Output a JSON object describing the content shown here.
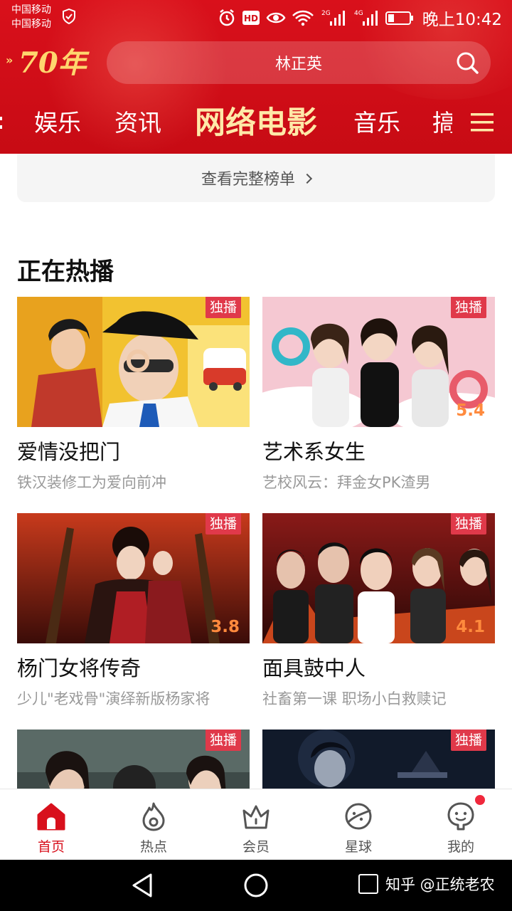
{
  "status_bar": {
    "carrier_line1": "中国移动",
    "carrier_line2": "中国移动",
    "network_1": "2G",
    "network_2": "4G",
    "time": "晚上10:42",
    "icons": [
      "shield-icon",
      "alarm-icon",
      "hd-icon",
      "eye-icon",
      "wifi-icon",
      "signal-icon",
      "battery-icon"
    ]
  },
  "header": {
    "logo_text": "70年",
    "search_text": "林正英",
    "tabs": [
      {
        "label": "娱乐",
        "active": false
      },
      {
        "label": "资讯",
        "active": false
      },
      {
        "label": "网络电影",
        "active": true
      },
      {
        "label": "音乐",
        "active": false
      },
      {
        "label": "搞",
        "active": false
      }
    ],
    "colors": {
      "bar": "#d4101a",
      "active_tab": "#ffe9a8"
    }
  },
  "content": {
    "full_list_label": "查看完整榜单",
    "section_title": "正在热播",
    "cards": [
      {
        "title": "爱情没把门",
        "subtitle": "铁汉装修工为爱向前冲",
        "badge": "独播",
        "score": ""
      },
      {
        "title": "艺术系女生",
        "subtitle": "艺校风云：拜金女PK渣男",
        "badge": "独播",
        "score": "5.4"
      },
      {
        "title": "杨门女将传奇",
        "subtitle": "少儿\"老戏骨\"演绎新版杨家将",
        "badge": "独播",
        "score": "3.8"
      },
      {
        "title": "面具鼓中人",
        "subtitle": "社畜第一课 职场小白救赎记",
        "badge": "独播",
        "score": "4.1"
      },
      {
        "title": "",
        "subtitle": "",
        "badge": "独播",
        "score": ""
      },
      {
        "title": "",
        "subtitle": "",
        "badge": "独播",
        "score": ""
      }
    ]
  },
  "bottom_nav": {
    "items": [
      {
        "label": "首页",
        "icon": "home-icon",
        "active": true
      },
      {
        "label": "热点",
        "icon": "flame-icon",
        "active": false
      },
      {
        "label": "会员",
        "icon": "crown-icon",
        "active": false
      },
      {
        "label": "星球",
        "icon": "planet-icon",
        "active": false
      },
      {
        "label": "我的",
        "icon": "profile-icon",
        "active": false,
        "has_dot": true
      }
    ]
  },
  "system_nav": {
    "watermark": "知乎 @正统老农"
  }
}
